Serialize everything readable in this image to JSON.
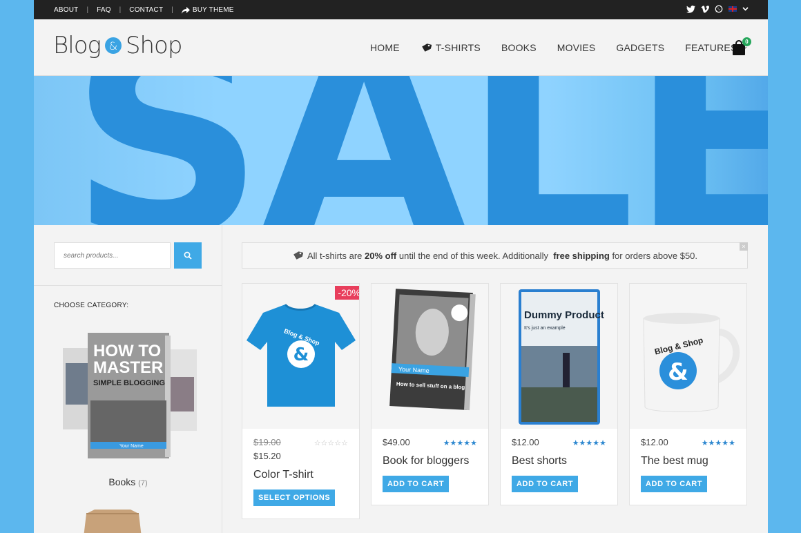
{
  "topbar": {
    "links": [
      "ABOUT",
      "FAQ",
      "CONTACT"
    ],
    "buy_theme": "BUY THEME",
    "icons": [
      "twitter-icon",
      "vimeo-icon",
      "whatsapp-icon",
      "uk-flag-icon",
      "chevron-down-icon"
    ]
  },
  "header": {
    "logo_left": "Blog",
    "logo_amp": "&",
    "logo_right": "Shop",
    "nav": [
      {
        "label": "HOME"
      },
      {
        "label": "T-SHIRTS",
        "icon": "tag-icon"
      },
      {
        "label": "BOOKS"
      },
      {
        "label": "MOVIES"
      },
      {
        "label": "GADGETS"
      },
      {
        "label": "FEATURES",
        "icon": "chevron-down-icon"
      }
    ],
    "cart_count": "0"
  },
  "banner": {
    "text": "SALE"
  },
  "sidebar": {
    "search_placeholder": "search products...",
    "category_heading": "CHOOSE CATEGORY:",
    "category": {
      "name": "Books",
      "count": "(7)"
    },
    "book_cover": {
      "line1": "HOW TO",
      "line2": "MASTER",
      "line3": "SIMPLE BLOGGING",
      "name": "Your Name"
    }
  },
  "notice": {
    "pre": "All t-shirts are ",
    "bold1": "20% off",
    "mid": " until the end of this week. Additionally ",
    "bold2": "free shipping",
    "post": " for orders above $50.",
    "close": "×"
  },
  "products": [
    {
      "name": "Color T-shirt",
      "old_price": "$19.00",
      "price": "$15.20",
      "rating": 0,
      "badge": "-20%",
      "button": "SELECT OPTIONS",
      "graphic": "Blog & Shop"
    },
    {
      "name": "Book for bloggers",
      "price": "$49.00",
      "rating": 4.5,
      "button": "ADD TO CART",
      "graphic_label": "Your Name",
      "graphic_text": "How to sell stuff on a blog"
    },
    {
      "name": "Best shorts",
      "price": "$12.00",
      "rating": 4.5,
      "button": "ADD TO CART",
      "graphic_title": "Dummy Product",
      "graphic_sub": "It's just an example"
    },
    {
      "name": "The best mug",
      "price": "$12.00",
      "rating": 4.5,
      "button": "ADD TO CART",
      "graphic": "Blog & Shop"
    }
  ],
  "colors": {
    "accent": "#3fa9e6",
    "sale_badge": "#e83e5c",
    "page_bg": "#5cb7ee",
    "topbar": "#222222",
    "banner_text": "#2a8fdb"
  }
}
